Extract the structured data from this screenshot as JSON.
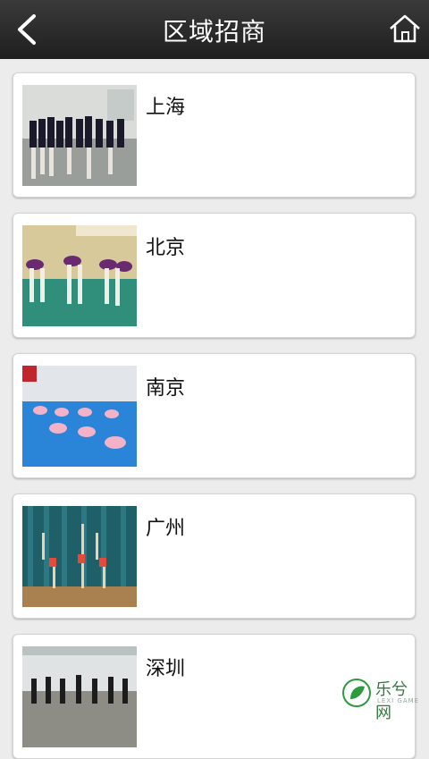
{
  "header": {
    "title": "区域招商"
  },
  "icons": {
    "back": "chevron-left-icon",
    "home": "home-icon"
  },
  "cards": [
    {
      "label": "上海"
    },
    {
      "label": "北京"
    },
    {
      "label": "南京"
    },
    {
      "label": "广州"
    },
    {
      "label": "深圳"
    }
  ],
  "watermark": {
    "text": "乐兮网",
    "sub": "LEXI GAME"
  }
}
